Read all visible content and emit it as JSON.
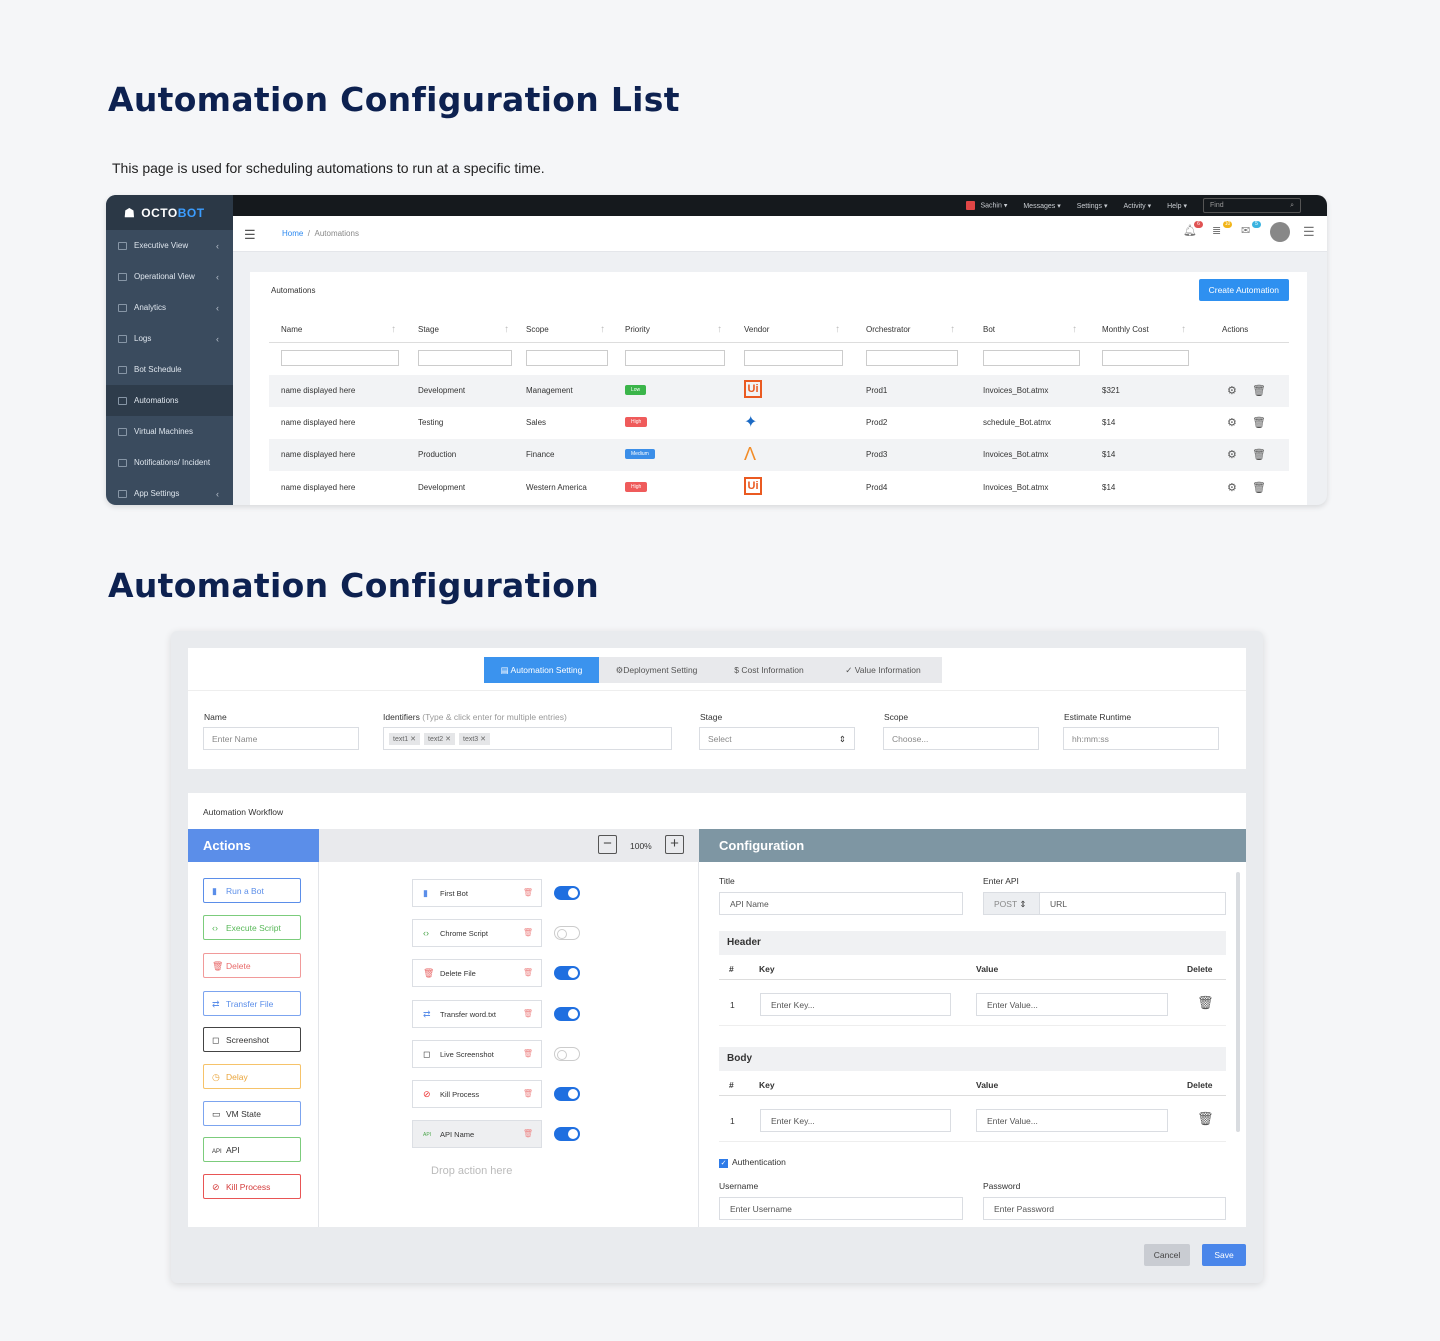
{
  "titles": {
    "list": "Automation Configuration List",
    "config": "Automation Configuration"
  },
  "description": "This page is used for scheduling automations to run at a specific time.",
  "app": {
    "logo_a": "OCTO",
    "logo_b": "BOT"
  },
  "sidebar": {
    "items": [
      {
        "label": "Executive View"
      },
      {
        "label": "Operational View"
      },
      {
        "label": "Analytics"
      },
      {
        "label": "Logs"
      },
      {
        "label": "Bot Schedule"
      },
      {
        "label": "Automations"
      },
      {
        "label": "Virtual Machines"
      },
      {
        "label": "Notifications/ Incident"
      },
      {
        "label": "App Settings"
      }
    ]
  },
  "topbar": {
    "user": "Sachin",
    "messages": "Messages",
    "settings": "Settings",
    "activity": "Activity",
    "help": "Help",
    "find": "Find"
  },
  "breadcrumb": {
    "home": "Home",
    "sep": "/",
    "current": "Automations"
  },
  "badges": {
    "b1": "6",
    "b2": "10",
    "b3": "5"
  },
  "list": {
    "title": "Automations",
    "create": "Create Automation",
    "columns": [
      "Name",
      "Stage",
      "Scope",
      "Priority",
      "Vendor",
      "Orchestrator",
      "Bot",
      "Monthly Cost",
      "Actions"
    ],
    "rows": [
      {
        "name": "name displayed here",
        "stage": "Development",
        "scope": "Management",
        "priority": "Low",
        "orch": "Prod1",
        "bot": "Invoices_Bot.atmx",
        "cost": "$321"
      },
      {
        "name": "name displayed here",
        "stage": "Testing",
        "scope": "Sales",
        "priority": "High",
        "orch": "Prod2",
        "bot": "schedule_Bot.atmx",
        "cost": "$14"
      },
      {
        "name": "name displayed here",
        "stage": "Production",
        "scope": "Finance",
        "priority": "Medium",
        "orch": "Prod3",
        "bot": "Invoices_Bot.atmx",
        "cost": "$14"
      },
      {
        "name": "name displayed here",
        "stage": "Development",
        "scope": "Western America",
        "priority": "High",
        "orch": "Prod4",
        "bot": "Invoices_Bot.atmx",
        "cost": "$14"
      }
    ]
  },
  "config": {
    "tabs": [
      "Automation Setting",
      "Deployment Setting",
      "Cost Information",
      "Value Information"
    ],
    "fields": {
      "name_label": "Name",
      "name_ph": "Enter Name",
      "ident_label": "Identifiers",
      "ident_hint": "(Type & click enter for multiple entries)",
      "chips": [
        "text1",
        "text2",
        "text3"
      ],
      "stage_label": "Stage",
      "stage_ph": "Select",
      "scope_label": "Scope",
      "scope_ph": "Choose...",
      "runtime_label": "Estimate Runtime",
      "runtime_ph": "hh:mm:ss"
    },
    "workflow_label": "Automation Workflow",
    "actions_title": "Actions",
    "actions": [
      "Run a Bot",
      "Execute Script",
      "Delete",
      "Transfer File",
      "Screenshot",
      "Delay",
      "VM State",
      "API",
      "Kill Process"
    ],
    "zoom": "100%",
    "nodes": [
      {
        "label": "First Bot",
        "on": true
      },
      {
        "label": "Chrome Script",
        "on": false
      },
      {
        "label": "Delete File",
        "on": true
      },
      {
        "label": "Transfer word.txt",
        "on": true
      },
      {
        "label": "Live Screenshot",
        "on": false
      },
      {
        "label": "Kill Process",
        "on": true
      },
      {
        "label": "API Name",
        "on": true
      }
    ],
    "drop": "Drop action here",
    "conf_title": "Configuration",
    "title_label": "Title",
    "title_value": "API Name",
    "api_label": "Enter API",
    "api_method": "POST",
    "api_url": "URL",
    "header": "Header",
    "body": "Body",
    "th": [
      "#",
      "Key",
      "Value",
      "Delete"
    ],
    "row_num": "1",
    "key_ph": "Enter Key...",
    "value_ph": "Enter Value...",
    "auth": "Authentication",
    "user_label": "Username",
    "user_ph": "Enter Username",
    "pass_label": "Password",
    "pass_ph": "Enter Password",
    "cancel": "Cancel",
    "save": "Save"
  },
  "colors": {
    "navy": "#0d2150",
    "accent": "#2e90f0",
    "low": "#3bb54a",
    "high": "#ef5b5b",
    "medium": "#3b8ee8"
  }
}
